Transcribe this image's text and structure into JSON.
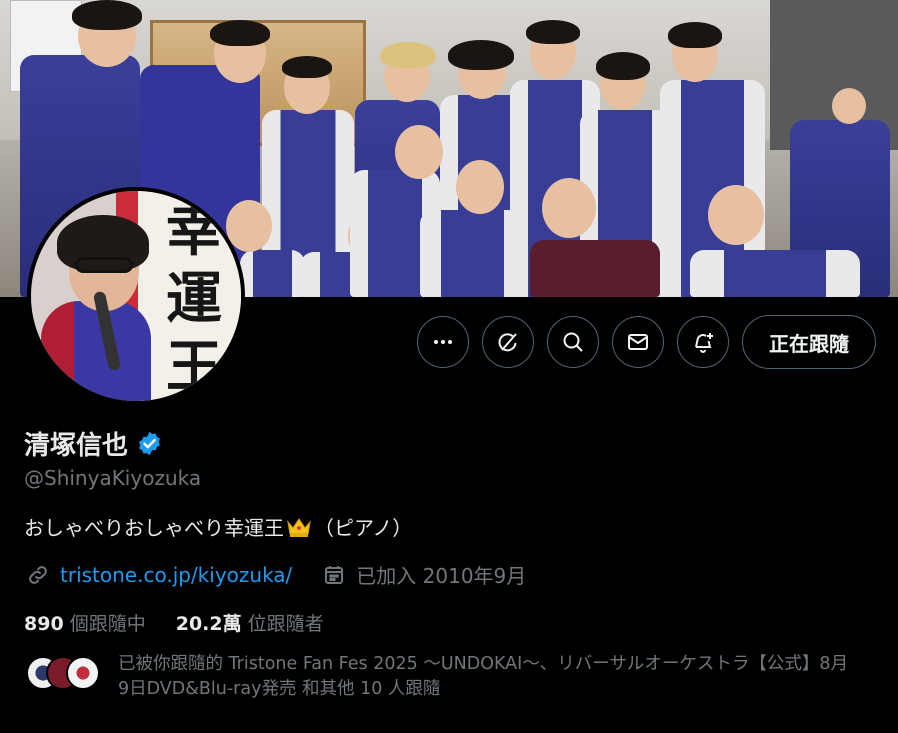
{
  "profile": {
    "display_name": "清塚信也",
    "handle": "@ShinyaKiyozuka",
    "bio": "おしゃべりおしゃべり幸運王",
    "bio_suffix": "（ピアノ）",
    "bio_emoji": "crown-emoji",
    "link": "tristone.co.jp/kiyozuka/",
    "joined": "已加入 2010年9月",
    "verified_color": "#1d9bf0"
  },
  "avatar": {
    "sign_chars": [
      "幸",
      "運",
      "王"
    ]
  },
  "actions": {
    "follow_label": "正在跟隨",
    "icons": [
      "more-icon",
      "grok-icon",
      "search-icon",
      "message-icon",
      "notification-icon"
    ]
  },
  "stats": {
    "following_count": "890",
    "following_label": "個跟隨中",
    "followers_count": "20.2萬",
    "followers_label": "位跟隨者"
  },
  "followed_by": {
    "text": "已被你跟隨的 Tristone Fan Fes 2025 ～UNDOKAI～、リバーサルオーケストラ【公式】8月9日DVD&Blu-ray発売 和其他 10 人跟隨"
  },
  "colors": {
    "background": "#000000",
    "link": "#1d9bf0",
    "secondary_text": "#71767b",
    "border": "#536471"
  }
}
